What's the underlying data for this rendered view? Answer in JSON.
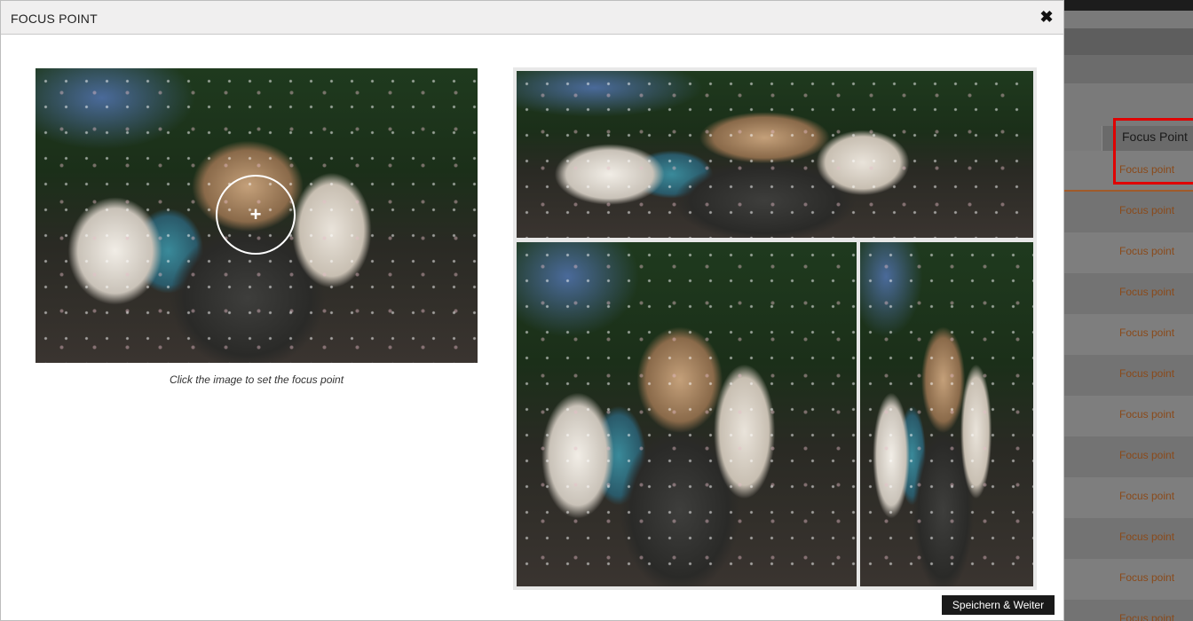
{
  "modal": {
    "title": "FOCUS POINT",
    "close_icon": "close-icon",
    "hint": "Click the image to set the focus point",
    "save_label": "Speichern & Weiter"
  },
  "background_table": {
    "column_header": "Focus Point",
    "row_link_label": "Focus point",
    "rows": [
      "Focus point",
      "Focus point",
      "Focus point",
      "Focus point",
      "Focus point",
      "Focus point",
      "Focus point",
      "Focus point",
      "Focus point",
      "Focus point",
      "Focus point",
      "Focus point"
    ],
    "highlight_color": "#e00000",
    "link_color": "#8a4a1a"
  }
}
